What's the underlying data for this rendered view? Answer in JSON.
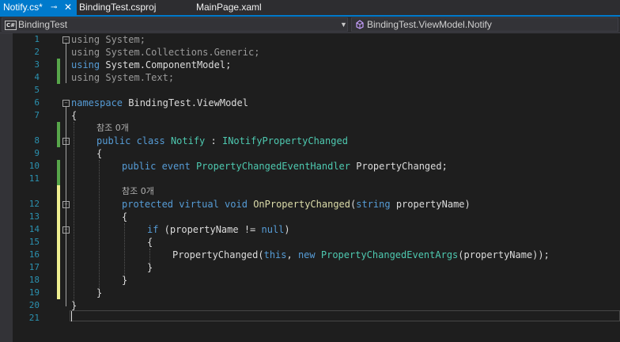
{
  "tabs": [
    {
      "label": "Notify.cs*",
      "active": true
    },
    {
      "label": "BindingTest.csproj",
      "active": false
    },
    {
      "label": "MainPage.xaml",
      "active": false
    }
  ],
  "tab_pin_icon": "pin-icon",
  "tab_close_icon": "close-icon",
  "nav": {
    "project": "BindingTest",
    "project_badge": "C#",
    "member": "BindingTest.ViewModel.Notify"
  },
  "colors": {
    "accent": "#007acc",
    "keyword": "#569cd6",
    "type": "#4ec9b0",
    "line_number": "#2b91af",
    "saved_change": "#57a64a",
    "unsaved_change": "#efef91"
  },
  "lens_text": "참조 0개",
  "lines": [
    {
      "n": "1",
      "t": "using System;"
    },
    {
      "n": "2",
      "t": "using System.Collections.Generic;"
    },
    {
      "n": "3",
      "t": "using System.ComponentModel;"
    },
    {
      "n": "4",
      "t": "using System.Text;"
    },
    {
      "n": "5",
      "t": ""
    },
    {
      "n": "6",
      "t": "namespace BindingTest.ViewModel"
    },
    {
      "n": "7",
      "t": "{"
    },
    {
      "n": "8",
      "t": "public class Notify : INotifyPropertyChanged"
    },
    {
      "n": "9",
      "t": "{"
    },
    {
      "n": "10",
      "t": "public event PropertyChangedEventHandler PropertyChanged;"
    },
    {
      "n": "11",
      "t": ""
    },
    {
      "n": "12",
      "t": "protected virtual void OnPropertyChanged(string propertyName)"
    },
    {
      "n": "13",
      "t": "{"
    },
    {
      "n": "14",
      "t": "if (propertyName != null)"
    },
    {
      "n": "15",
      "t": "{"
    },
    {
      "n": "16",
      "t": "PropertyChanged(this, new PropertyChangedEventArgs(propertyName));"
    },
    {
      "n": "17",
      "t": "}"
    },
    {
      "n": "18",
      "t": "}"
    },
    {
      "n": "19",
      "t": "}"
    },
    {
      "n": "20",
      "t": "}"
    },
    {
      "n": "21",
      "t": ""
    }
  ]
}
